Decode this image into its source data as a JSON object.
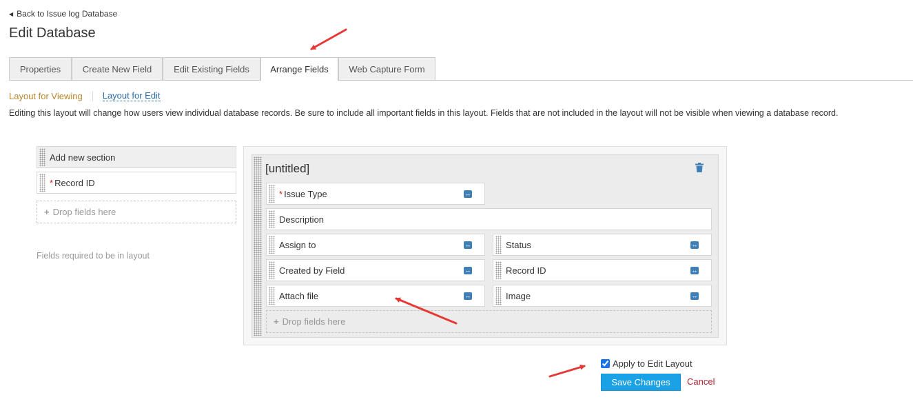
{
  "back_link": "Back to Issue log Database",
  "page_title": "Edit Database",
  "tabs": [
    {
      "label": "Properties"
    },
    {
      "label": "Create New Field"
    },
    {
      "label": "Edit Existing Fields"
    },
    {
      "label": "Arrange Fields"
    },
    {
      "label": "Web Capture Form"
    }
  ],
  "active_tab": "Arrange Fields",
  "subnav": {
    "viewing": "Layout for Viewing",
    "edit": "Layout for Edit"
  },
  "info_text": "Editing this layout will change how users view individual database records. Be sure to include all important fields in this layout. Fields that are not included in the layout will not be visible when viewing a database record.",
  "left_panel": {
    "add_section": "Add new section",
    "fields": [
      {
        "label": "Record ID",
        "required": true
      }
    ],
    "drop_label": "Drop fields here",
    "required_note": "Fields required to be in layout"
  },
  "section": {
    "title": "[untitled]",
    "fields": [
      {
        "label": "Issue Type",
        "required": true
      },
      {
        "label": "Description"
      },
      {
        "label": "Assign to"
      },
      {
        "label": "Status"
      },
      {
        "label": "Created by Field"
      },
      {
        "label": "Record ID"
      },
      {
        "label": "Attach file"
      },
      {
        "label": "Image"
      }
    ],
    "drop_label": "Drop fields here"
  },
  "apply_edit_layout": {
    "label": "Apply to Edit Layout",
    "checked": true
  },
  "save_label": "Save Changes",
  "cancel_label": "Cancel",
  "colors": {
    "accent": "#1aa1e6",
    "annotation_arrow": "#e53935",
    "cancel": "#b0202e",
    "viewing_link": "#b8862b"
  }
}
